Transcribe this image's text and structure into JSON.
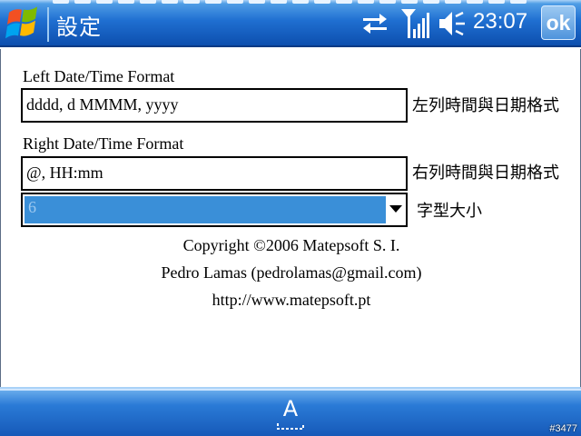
{
  "titlebar": {
    "title": "設定",
    "clock": "23:07",
    "ok_label": "ok",
    "icons": [
      "windows-start-icon",
      "sync-arrows-icon",
      "signal-icon",
      "volume-icon"
    ]
  },
  "form": {
    "left_format_label": "Left Date/Time Format",
    "left_format_value": "dddd, d MMMM, yyyy",
    "left_format_side": "左列時間與日期格式",
    "right_format_label": "Right Date/Time Format",
    "right_format_value": "@, HH:mm",
    "right_format_side": "右列時間與日期格式",
    "font_size_value": "6",
    "font_size_side": "字型大小"
  },
  "info": {
    "copyright": "Copyright ©2006 Matepsoft S. I.",
    "author": "Pedro Lamas (pedrolamas@gmail.com)",
    "url": "http://www.matepsoft.pt"
  },
  "bottombar": {
    "sip_label": "A",
    "corner_tag": "#3477"
  },
  "colors": {
    "titlebar_dark": "#0d4fae",
    "titlebar_light": "#4f9de6",
    "selection": "#3a8fd8"
  }
}
